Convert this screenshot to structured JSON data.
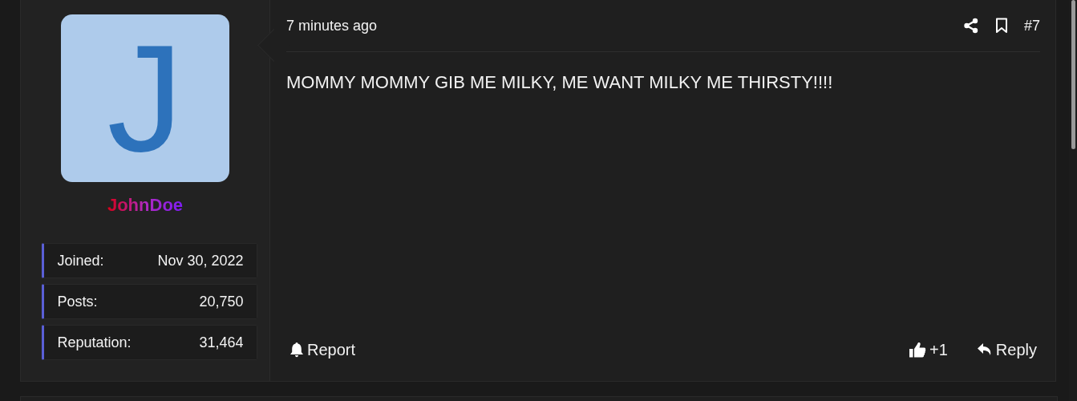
{
  "author": {
    "avatar_letter": "J",
    "username": "JohnDoe",
    "stats": [
      {
        "label": "Joined:",
        "value": "Nov 30, 2022"
      },
      {
        "label": "Posts:",
        "value": "20,750"
      },
      {
        "label": "Reputation:",
        "value": "31,464"
      }
    ]
  },
  "post": {
    "time": "7 minutes ago",
    "number": "#7",
    "body": "MOMMY MOMMY GIB ME MILKY, ME WANT MILKY ME THIRSTY!!!!",
    "actions": {
      "report": "Report",
      "like": "+1",
      "reply": "Reply"
    }
  }
}
